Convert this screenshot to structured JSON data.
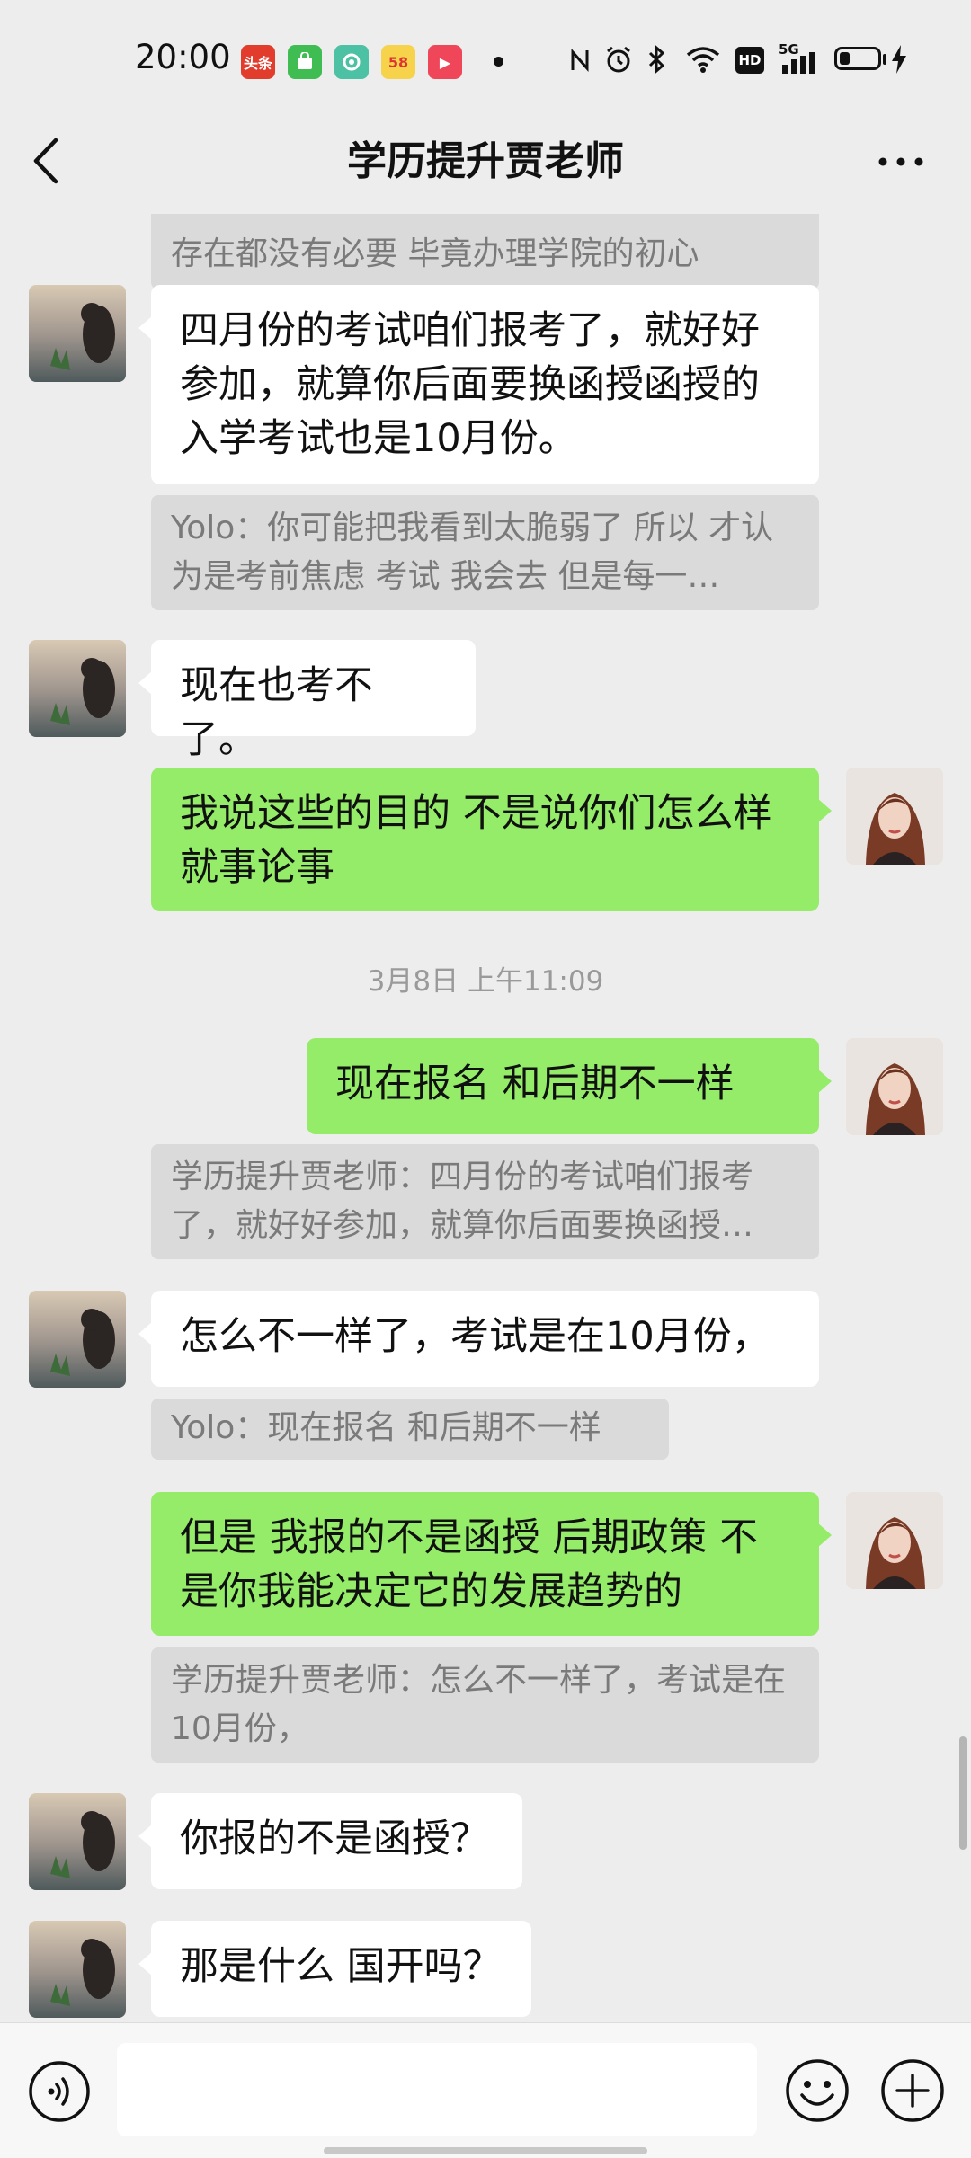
{
  "status_bar": {
    "time": "20:00",
    "apps": [
      {
        "name": "toutiao-app-icon",
        "label": "头条",
        "color": "#e23c2d"
      },
      {
        "name": "store-app-icon",
        "label": "",
        "color": "#3fbd52"
      },
      {
        "name": "camera-app-icon",
        "label": "",
        "color": "#4cc1a3"
      },
      {
        "name": "58-app-icon",
        "label": "58",
        "color": "#f6d34a"
      },
      {
        "name": "video-app-icon",
        "label": "▶",
        "color": "#f0465a"
      }
    ],
    "network_label": "5G",
    "hd_label": "HD"
  },
  "header": {
    "title": "学历提升贾老师"
  },
  "messages": {
    "m0_quote": "存在都没有必要 毕竟办理学院的初心",
    "m1_text": "四月份的考试咱们报考了，就好好参加，就算你后面要换函授函授的入学考试也是10月份。",
    "m2_quote": "Yolo：你可能把我看到太脆弱了 所以 才认为是考前焦虑 考试 我会去 但是每一…",
    "m3_text": "现在也考不了。",
    "m4_text": "我说这些的目的 不是说你们怎么样 就事论事",
    "timestamp": "3月8日 上午11:09",
    "m5_text": "现在报名 和后期不一样",
    "m6_quote": "学历提升贾老师：四月份的考试咱们报考了，就好好参加，就算你后面要换函授…",
    "m7_text": "怎么不一样了，考试是在10月份，",
    "m8_quote": "Yolo：现在报名 和后期不一样",
    "m9_text": "但是 我报的不是函授 后期政策 不是你我能决定它的发展趋势的",
    "m10_quote": "学历提升贾老师：怎么不一样了，考试是在10月份，",
    "m11_text": "你报的不是函授？",
    "m12_text": "那是什么 国开吗？"
  },
  "input": {
    "value": "",
    "placeholder": ""
  },
  "icons": {
    "back": "back-arrow-icon",
    "more": "more-options-icon",
    "voice": "voice-input-icon",
    "emoji": "emoji-icon",
    "plus": "plus-icon"
  },
  "colors": {
    "background": "#ededed",
    "outgoing_bubble": "#95ec69",
    "incoming_bubble": "#ffffff",
    "quote_block": "#dadada"
  }
}
